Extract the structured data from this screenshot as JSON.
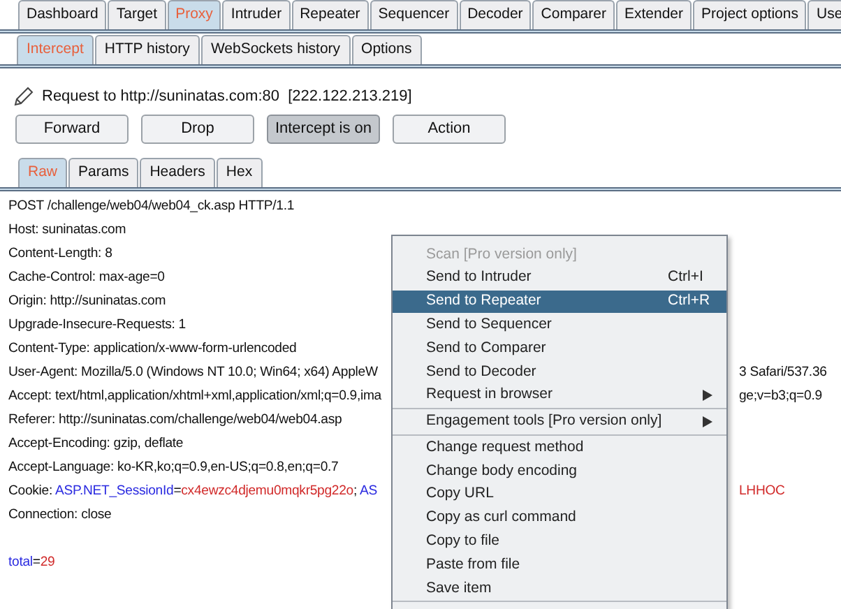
{
  "main_tabs": [
    {
      "label": "Dashboard",
      "selected": false
    },
    {
      "label": "Target",
      "selected": false
    },
    {
      "label": "Proxy",
      "selected": true
    },
    {
      "label": "Intruder",
      "selected": false
    },
    {
      "label": "Repeater",
      "selected": false
    },
    {
      "label": "Sequencer",
      "selected": false
    },
    {
      "label": "Decoder",
      "selected": false
    },
    {
      "label": "Comparer",
      "selected": false
    },
    {
      "label": "Extender",
      "selected": false
    },
    {
      "label": "Project options",
      "selected": false
    },
    {
      "label": "Use",
      "selected": false
    }
  ],
  "proxy_tabs": [
    {
      "label": "Intercept",
      "selected": true
    },
    {
      "label": "HTTP history",
      "selected": false
    },
    {
      "label": "WebSockets history",
      "selected": false
    },
    {
      "label": "Options",
      "selected": false
    }
  ],
  "request_info": "Request to http://suninatas.com:80  [222.122.213.219]",
  "buttons": [
    {
      "label": "Forward",
      "on": false
    },
    {
      "label": "Drop",
      "on": false
    },
    {
      "label": "Intercept is on",
      "on": true
    },
    {
      "label": "Action",
      "on": false
    }
  ],
  "view_tabs": [
    {
      "label": "Raw",
      "selected": true
    },
    {
      "label": "Params",
      "selected": false
    },
    {
      "label": "Headers",
      "selected": false
    },
    {
      "label": "Hex",
      "selected": false
    }
  ],
  "request_lines": [
    {
      "segments": [
        {
          "kind": "plain",
          "text": "POST /challenge/web04/web04_ck.asp HTTP/1.1"
        }
      ]
    },
    {
      "segments": [
        {
          "kind": "plain",
          "text": "Host: suninatas.com"
        }
      ]
    },
    {
      "segments": [
        {
          "kind": "plain",
          "text": "Content-Length: 8"
        }
      ]
    },
    {
      "segments": [
        {
          "kind": "plain",
          "text": "Cache-Control: max-age=0"
        }
      ]
    },
    {
      "segments": [
        {
          "kind": "plain",
          "text": "Origin: http://suninatas.com"
        }
      ]
    },
    {
      "segments": [
        {
          "kind": "plain",
          "text": "Upgrade-Insecure-Requests: 1"
        }
      ]
    },
    {
      "segments": [
        {
          "kind": "plain",
          "text": "Content-Type: application/x-www-form-urlencoded"
        }
      ]
    },
    {
      "segments": [
        {
          "kind": "plain",
          "text": "User-Agent: Mozilla/5.0 (Windows NT 10.0; Win64; x64) AppleW"
        }
      ],
      "overflow": [
        {
          "kind": "plain",
          "text": "3 Safari/537.36"
        }
      ]
    },
    {
      "segments": [
        {
          "kind": "plain",
          "text": "Accept: text/html,application/xhtml+xml,application/xml;q=0.9,ima"
        }
      ],
      "overflow": [
        {
          "kind": "plain",
          "text": "ge;v=b3;q=0.9"
        }
      ]
    },
    {
      "segments": [
        {
          "kind": "plain",
          "text": "Referer: http://suninatas.com/challenge/web04/web04.asp"
        }
      ]
    },
    {
      "segments": [
        {
          "kind": "plain",
          "text": "Accept-Encoding: gzip, deflate"
        }
      ]
    },
    {
      "segments": [
        {
          "kind": "plain",
          "text": "Accept-Language: ko-KR,ko;q=0.9,en-US;q=0.8,en;q=0.7"
        }
      ]
    },
    {
      "segments": [
        {
          "kind": "plain",
          "text": "Cookie: "
        },
        {
          "kind": "name",
          "text": "ASP.NET_SessionId"
        },
        {
          "kind": "plain",
          "text": "="
        },
        {
          "kind": "value",
          "text": "cx4ewzc4djemu0mqkr5pg22o"
        },
        {
          "kind": "plain",
          "text": "; "
        },
        {
          "kind": "name",
          "text": "AS"
        }
      ],
      "overflow": [
        {
          "kind": "value",
          "text": "LHHOC"
        }
      ]
    },
    {
      "segments": [
        {
          "kind": "plain",
          "text": "Connection: close"
        }
      ]
    }
  ],
  "request_body": [
    {
      "kind": "name",
      "text": "total"
    },
    {
      "kind": "plain",
      "text": "="
    },
    {
      "kind": "value",
      "text": "29"
    }
  ],
  "context_menu": [
    {
      "kind": "item",
      "label": "Scan [Pro version only]",
      "disabled": true,
      "selected": false
    },
    {
      "kind": "item",
      "label": "Send to Intruder",
      "shortcut": "Ctrl+I",
      "disabled": false,
      "selected": false
    },
    {
      "kind": "item",
      "label": "Send to Repeater",
      "shortcut": "Ctrl+R",
      "disabled": false,
      "selected": true
    },
    {
      "kind": "item",
      "label": "Send to Sequencer",
      "disabled": false,
      "selected": false
    },
    {
      "kind": "item",
      "label": "Send to Comparer",
      "disabled": false,
      "selected": false
    },
    {
      "kind": "item",
      "label": "Send to Decoder",
      "disabled": false,
      "selected": false
    },
    {
      "kind": "submenu",
      "label": "Request in browser",
      "disabled": false,
      "selected": false
    },
    {
      "kind": "separator"
    },
    {
      "kind": "submenu",
      "label": "Engagement tools [Pro version only]",
      "disabled": false,
      "selected": false
    },
    {
      "kind": "separator"
    },
    {
      "kind": "item",
      "label": "Change request method",
      "disabled": false,
      "selected": false
    },
    {
      "kind": "item",
      "label": "Change body encoding",
      "disabled": false,
      "selected": false
    },
    {
      "kind": "item",
      "label": "Copy URL",
      "disabled": false,
      "selected": false
    },
    {
      "kind": "item",
      "label": "Copy as curl command",
      "disabled": false,
      "selected": false
    },
    {
      "kind": "item",
      "label": "Copy to file",
      "disabled": false,
      "selected": false
    },
    {
      "kind": "item",
      "label": "Paste from file",
      "disabled": false,
      "selected": false
    },
    {
      "kind": "item",
      "label": "Save item",
      "disabled": false,
      "selected": false
    },
    {
      "kind": "separator"
    }
  ]
}
